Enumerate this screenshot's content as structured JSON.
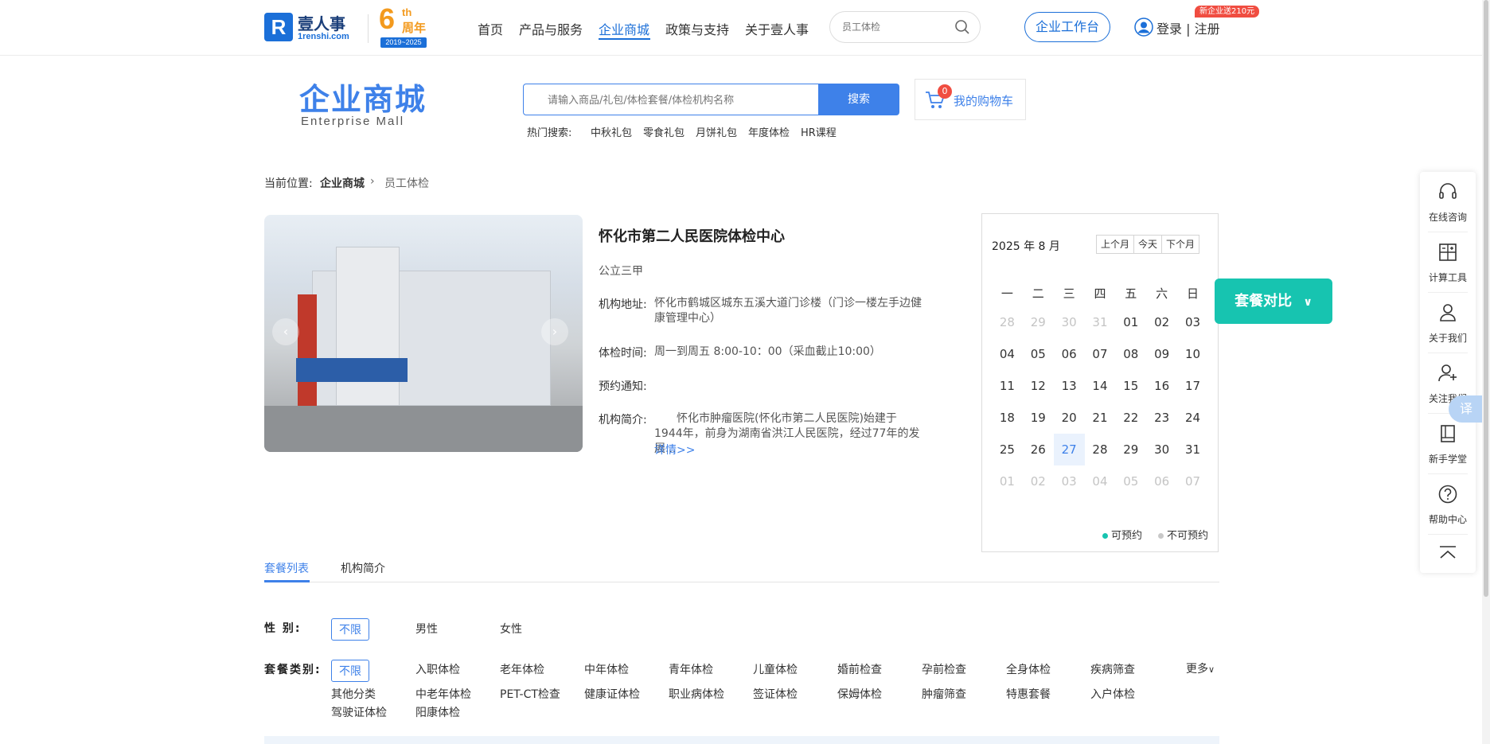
{
  "header": {
    "logo_name": "壹人事",
    "logo_domain": "1renshi.com",
    "anniversary": {
      "number": "6",
      "suffix": "th",
      "label": "周年",
      "years": "2019~2025"
    },
    "nav": [
      {
        "label": "首页"
      },
      {
        "label": "产品与服务"
      },
      {
        "label": "企业商城",
        "active": true
      },
      {
        "label": "政策与支持"
      },
      {
        "label": "关于壹人事"
      }
    ],
    "search_placeholder": "员工体检",
    "workbench_label": "企业工作台",
    "login_label": "登录 | 注册",
    "promo_badge": "新企业送210元"
  },
  "mall": {
    "title": "企业商城",
    "subtitle": "Enterprise  Mall",
    "search_placeholder": "请输入商品/礼包/体检套餐/体检机构名称",
    "search_button": "搜索",
    "hot_label": "热门搜索:",
    "hot_items": [
      "中秋礼包",
      "零食礼包",
      "月饼礼包",
      "年度体检",
      "HR课程"
    ],
    "cart_label": "我的购物车",
    "cart_count": "0"
  },
  "breadcrumb": {
    "prefix": "当前位置:",
    "items": [
      "企业商城",
      "员工体检"
    ]
  },
  "institution": {
    "name": "怀化市第二人民医院体检中心",
    "level": "公立三甲",
    "address_label": "机构地址:",
    "address": "怀化市鹤城区城东五溪大道门诊楼（门诊一楼左手边健康管理中心）",
    "hours_label": "体检时间:",
    "hours": "周一到周五 8:00-10：00（采血截止10:00）",
    "notice_label": "预约通知:",
    "notice": "",
    "intro_label": "机构简介:",
    "intro": "怀化市肿瘤医院(怀化市第二人民医院)始建于1944年，前身为湖南省洪江人民医院，经过77年的发展...",
    "more_link": "详情>>"
  },
  "calendar": {
    "title": "2025 年 8 月",
    "buttons": [
      "上个月",
      "今天",
      "下个月"
    ],
    "weekdays": [
      "一",
      "二",
      "三",
      "四",
      "五",
      "六",
      "日"
    ],
    "weeks": [
      [
        {
          "d": "28",
          "dim": true
        },
        {
          "d": "29",
          "dim": true
        },
        {
          "d": "30",
          "dim": true
        },
        {
          "d": "31",
          "dim": true
        },
        {
          "d": "01"
        },
        {
          "d": "02"
        },
        {
          "d": "03"
        }
      ],
      [
        {
          "d": "04"
        },
        {
          "d": "05"
        },
        {
          "d": "06"
        },
        {
          "d": "07"
        },
        {
          "d": "08"
        },
        {
          "d": "09"
        },
        {
          "d": "10"
        }
      ],
      [
        {
          "d": "11"
        },
        {
          "d": "12"
        },
        {
          "d": "13"
        },
        {
          "d": "14"
        },
        {
          "d": "15"
        },
        {
          "d": "16"
        },
        {
          "d": "17"
        }
      ],
      [
        {
          "d": "18"
        },
        {
          "d": "19"
        },
        {
          "d": "20"
        },
        {
          "d": "21"
        },
        {
          "d": "22"
        },
        {
          "d": "23"
        },
        {
          "d": "24"
        }
      ],
      [
        {
          "d": "25"
        },
        {
          "d": "26"
        },
        {
          "d": "27",
          "today": true
        },
        {
          "d": "28"
        },
        {
          "d": "29"
        },
        {
          "d": "30"
        },
        {
          "d": "31"
        }
      ],
      [
        {
          "d": "01",
          "dim": true
        },
        {
          "d": "02",
          "dim": true
        },
        {
          "d": "03",
          "dim": true
        },
        {
          "d": "04",
          "dim": true
        },
        {
          "d": "05",
          "dim": true
        },
        {
          "d": "06",
          "dim": true
        },
        {
          "d": "07",
          "dim": true
        }
      ]
    ],
    "legend_available": "可预约",
    "legend_unavailable": "不可预约",
    "available_color": "#17c4b0",
    "unavailable_color": "#c8c8c8"
  },
  "compare_button": "套餐对比",
  "tabs": [
    {
      "label": "套餐列表",
      "active": true
    },
    {
      "label": "机构简介"
    }
  ],
  "filters": {
    "gender_label": "性    别:",
    "gender_options": [
      "不限",
      "男性",
      "女性"
    ],
    "category_label": "套餐类别:",
    "category_rows": [
      [
        "不限",
        "入职体检",
        "老年体检",
        "中年体检",
        "青年体检",
        "儿童体检",
        "婚前检查",
        "孕前检查",
        "全身体检",
        "疾病筛查"
      ],
      [
        "其他分类",
        "中老年体检",
        "PET-CT检查",
        "健康证体检",
        "职业病体检",
        "签证体检",
        "保姆体检",
        "肿瘤筛查",
        "特惠套餐",
        "入户体检"
      ],
      [
        "驾驶证体检",
        "阳康体检"
      ]
    ],
    "more_label": "更多"
  },
  "sidebar": [
    {
      "label": "在线咨询",
      "icon": "headset-icon"
    },
    {
      "label": "计算工具",
      "icon": "calculator-icon"
    },
    {
      "label": "关于我们",
      "icon": "user-icon"
    },
    {
      "label": "关注我们",
      "icon": "user-add-icon"
    },
    {
      "label": "新手学堂",
      "icon": "book-icon"
    },
    {
      "label": "帮助中心",
      "icon": "help-icon"
    }
  ],
  "translate_label": "译",
  "colors": {
    "brand": "#1b6fd8",
    "accent": "#3e81e9",
    "compare": "#17c4b0",
    "badge": "#f04d41"
  }
}
